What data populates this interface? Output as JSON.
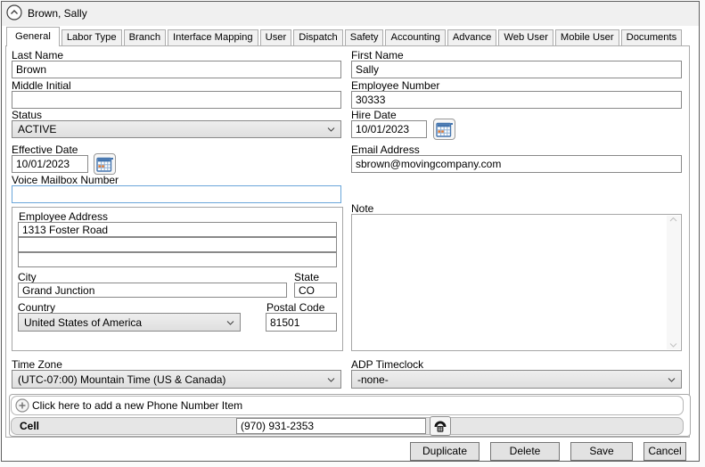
{
  "window": {
    "title": "Brown, Sally"
  },
  "tabs": [
    {
      "label": "General",
      "active": true
    },
    {
      "label": "Labor Type",
      "active": false
    },
    {
      "label": "Branch",
      "active": false
    },
    {
      "label": "Interface Mapping",
      "active": false
    },
    {
      "label": "User",
      "active": false
    },
    {
      "label": "Dispatch",
      "active": false
    },
    {
      "label": "Safety",
      "active": false
    },
    {
      "label": "Accounting",
      "active": false
    },
    {
      "label": "Advance",
      "active": false
    },
    {
      "label": "Web User",
      "active": false
    },
    {
      "label": "Mobile User",
      "active": false
    },
    {
      "label": "Documents",
      "active": false
    }
  ],
  "fields": {
    "last_name": {
      "label": "Last Name",
      "value": "Brown"
    },
    "first_name": {
      "label": "First Name",
      "value": "Sally"
    },
    "middle_initial": {
      "label": "Middle Initial",
      "value": ""
    },
    "employee_number": {
      "label": "Employee Number",
      "value": "30333"
    },
    "status": {
      "label": "Status",
      "value": "ACTIVE"
    },
    "hire_date": {
      "label": "Hire Date",
      "value": "10/01/2023"
    },
    "effective_date": {
      "label": "Effective Date",
      "value": "10/01/2023"
    },
    "email": {
      "label": "Email Address",
      "value": "sbrown@movingcompany.com"
    },
    "voice_mailbox": {
      "label": "Voice Mailbox Number",
      "value": ""
    },
    "note": {
      "label": "Note",
      "value": ""
    },
    "time_zone": {
      "label": "Time Zone",
      "value": "(UTC-07:00) Mountain Time (US & Canada)"
    },
    "adp_timeclock": {
      "label": "ADP Timeclock",
      "value": "-none-"
    }
  },
  "address": {
    "group_label": "Employee Address",
    "line1": "1313 Foster Road",
    "line2": "",
    "line3": "",
    "city": {
      "label": "City",
      "value": "Grand Junction"
    },
    "state": {
      "label": "State",
      "value": "CO"
    },
    "country": {
      "label": "Country",
      "value": "United States of America"
    },
    "postal": {
      "label": "Postal Code",
      "value": "81501"
    }
  },
  "phone": {
    "add_label": "Click here to add a new Phone Number Item",
    "items": [
      {
        "type": "Cell",
        "number": "(970) 931-2353"
      }
    ]
  },
  "footer": {
    "buttons": [
      "Duplicate",
      "Delete",
      "Save",
      "Cancel"
    ]
  },
  "colors": {
    "focus_border": "#6aa6da",
    "header_bg": "#f0f0f0",
    "combo_bg": "#e2e2e2"
  }
}
